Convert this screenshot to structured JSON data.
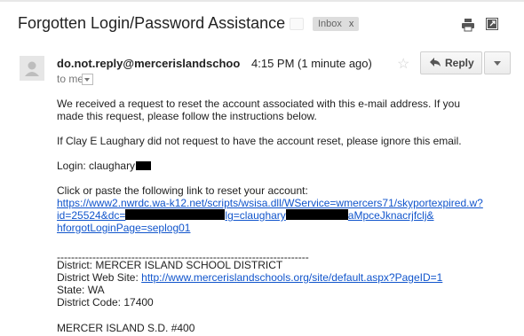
{
  "email": {
    "subject": "Forgotten Login/Password Assistance",
    "label": "Inbox",
    "label_remove": "x",
    "sender": "do.not.reply@mercerislandschools.org",
    "time": "4:15 PM (1 minute ago)",
    "star": "☆",
    "reply_label": "Reply",
    "recipient": "to me"
  },
  "body": {
    "p1_line1": "We received a request to reset the account associated with this e-mail address. If you",
    "p1_line2": "made this request, please follow the instructions below.",
    "p2": "If Clay E Laughary did not request to have the account reset, please ignore this email.",
    "login": "Login: claughary",
    "p3": "Click or paste the following link to reset your account:",
    "link_line1": "https://www2.nwrdc.wa-k12.net/scripts/wsisa.dll/WService=wmercers71/skyportexpired.w?",
    "link_line2_a": "id=25524&dc=",
    "link_line2_b": "lg=claughary",
    "link_line2_c": "aMpceJknacrjfclj&",
    "link_line3": "hforgotLoginPage=seplog01",
    "separator": "-----------------------------------------------------------------------",
    "district": "District: MERCER ISLAND SCHOOL DISTRICT",
    "website_label": "District Web Site: ",
    "website_url": "http://www.mercerislandschools.org/site/default.aspx?PageID=1",
    "state": "State: WA",
    "district_code": "District Code: 17400",
    "sd": "MERCER ISLAND S.D. #400"
  },
  "icons": {
    "print": "print-icon",
    "new_window": "new-window-icon",
    "reply": "reply-arrow-icon",
    "more": "chevron-down-icon",
    "avatar": "person-icon"
  },
  "colors": {
    "link": "#1155cc",
    "tag_bg": "#dddddd",
    "redaction": "#000000"
  }
}
